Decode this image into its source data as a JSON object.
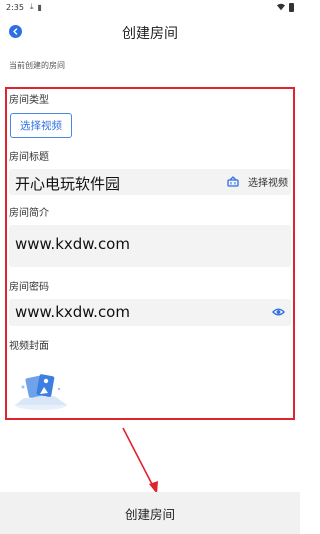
{
  "status_bar": {
    "time": "2:35",
    "icons": [
      "download-icon",
      "sim-card-icon",
      "wifi-icon",
      "battery-icon"
    ]
  },
  "header": {
    "back_icon": "chevron-left-icon",
    "title": "创建房间"
  },
  "caption": "当前创建的房间",
  "form": {
    "room_type_label": "房间类型",
    "select_video_button": "选择视频",
    "room_title_label": "房间标题",
    "room_title_value": "开心电玩软件园",
    "title_action_label": "选择视频",
    "title_action_icon": "basket-icon",
    "room_intro_label": "房间简介",
    "room_intro_value": "www.kxdw.com",
    "room_password_label": "房间密码",
    "room_password_value": "www.kxdw.com",
    "password_toggle_icon": "eye-icon",
    "video_cover_label": "视频封面",
    "cover_icon": "image-placeholder-icon"
  },
  "footer": {
    "create_button": "创建房间"
  },
  "colors": {
    "accent": "#2f6fe3",
    "annotation_red": "#e0242e",
    "field_background": "#f3f3f4"
  }
}
